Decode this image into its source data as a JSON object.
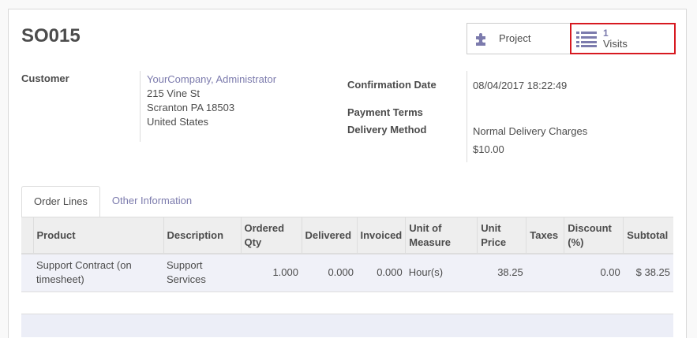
{
  "record": {
    "title": "SO015"
  },
  "smart_buttons": {
    "project": {
      "label": "Project",
      "icon": "puzzle-icon"
    },
    "visits": {
      "count": "1",
      "label": "Visits",
      "icon": "list-icon"
    }
  },
  "customer": {
    "label": "Customer",
    "name": "YourCompany, Administrator",
    "street": "215 Vine St",
    "city": "Scranton PA 18503",
    "country": "United States"
  },
  "details": {
    "confirmation_date_label": "Confirmation Date",
    "confirmation_date": "08/04/2017 18:22:49",
    "payment_terms_label": "Payment Terms",
    "delivery_method_label": "Delivery Method",
    "delivery_method": "Normal Delivery Charges",
    "delivery_price": "$10.00"
  },
  "tabs": [
    {
      "label": "Order Lines",
      "active": true
    },
    {
      "label": "Other Information",
      "active": false
    }
  ],
  "order_lines": {
    "headers": [
      "Product",
      "Description",
      "Ordered Qty",
      "Delivered",
      "Invoiced",
      "Unit of Measure",
      "Unit Price",
      "Taxes",
      "Discount (%)",
      "Subtotal"
    ],
    "rows": [
      {
        "product": "Support Contract (on timesheet)",
        "description": "Support Services",
        "ordered_qty": "1.000",
        "delivered": "0.000",
        "invoiced": "0.000",
        "uom": "Hour(s)",
        "unit_price": "38.25",
        "taxes": "",
        "discount": "0.00",
        "subtotal": "$ 38.25"
      }
    ]
  },
  "colors": {
    "accent": "#7c7bad",
    "highlight_border": "#d71920"
  }
}
